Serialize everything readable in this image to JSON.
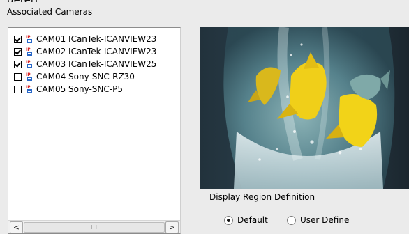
{
  "window_title_fragment": "uerert",
  "associated_cameras": {
    "title": "Associated Cameras",
    "cameras": [
      {
        "label": "CAM01 ICanTek-ICANVIEW23",
        "checked": true
      },
      {
        "label": "CAM02 ICanTek-ICANVIEW23",
        "checked": true
      },
      {
        "label": "CAM03 ICanTek-ICANVIEW25",
        "checked": true
      },
      {
        "label": "CAM04 Sony-SNC-RZ30",
        "checked": false
      },
      {
        "label": "CAM05 Sony-SNC-P5",
        "checked": false
      }
    ],
    "icon_text": "IP",
    "scroll_thumb_text": "III",
    "scroll_left_glyph": "<",
    "scroll_right_glyph": ">"
  },
  "preview": {
    "icon": "camera-preview-image"
  },
  "display_region": {
    "legend": "Display Region Definition",
    "options": [
      {
        "label": "Default",
        "selected": true
      },
      {
        "label": "User Define",
        "selected": false
      }
    ]
  },
  "colors": {
    "background": "#ebebeb",
    "icon_red": "#d81e1e",
    "icon_blue": "#2a68c8"
  }
}
